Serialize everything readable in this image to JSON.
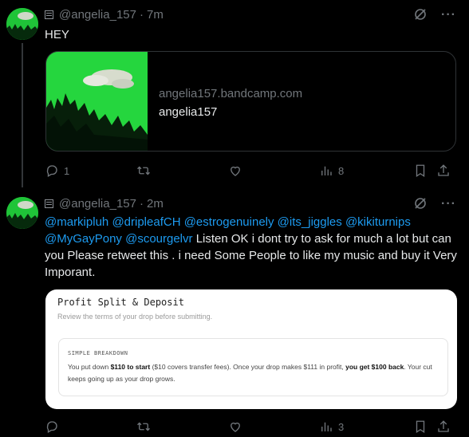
{
  "tweets": [
    {
      "handle": "@angelia_157",
      "time": "7m",
      "text": "HEY",
      "card": {
        "domain": "angelia157.bandcamp.com",
        "title": "angelia157"
      },
      "actions": {
        "replies": "1",
        "retweets": "",
        "likes": "",
        "views": "8"
      }
    },
    {
      "handle": "@angelia_157",
      "time": "2m",
      "mentions": [
        "@markipluh",
        "@dripleafCH",
        "@estrogenuinely",
        "@its_jiggles",
        "@kikiturnips",
        "@MyGayPony",
        "@scourgelvr"
      ],
      "text": "Listen OK i dont try to ask for much a lot but can you Please retweet  this . i need Some People to like my music and buy it Very Imporant.",
      "image": {
        "title": "Profit Split & Deposit",
        "subtitle": "Review the terms of your drop before submitting.",
        "box_label": "SIMPLE BREAKDOWN",
        "box_text_1": "You put down ",
        "box_bold_1": "$110 to start",
        "box_text_2": " ($10 covers transfer fees). Once your drop makes $111 in profit, ",
        "box_bold_2": "you get $100 back",
        "box_text_3": ". Your cut keeps going up as your drop grows."
      },
      "actions": {
        "replies": "",
        "retweets": "",
        "likes": "",
        "views": "3"
      }
    }
  ],
  "icons": [
    "reply-icon",
    "retweet-icon",
    "like-icon",
    "views-icon",
    "bookmark-icon",
    "share-icon",
    "grok-icon",
    "more-icon"
  ]
}
